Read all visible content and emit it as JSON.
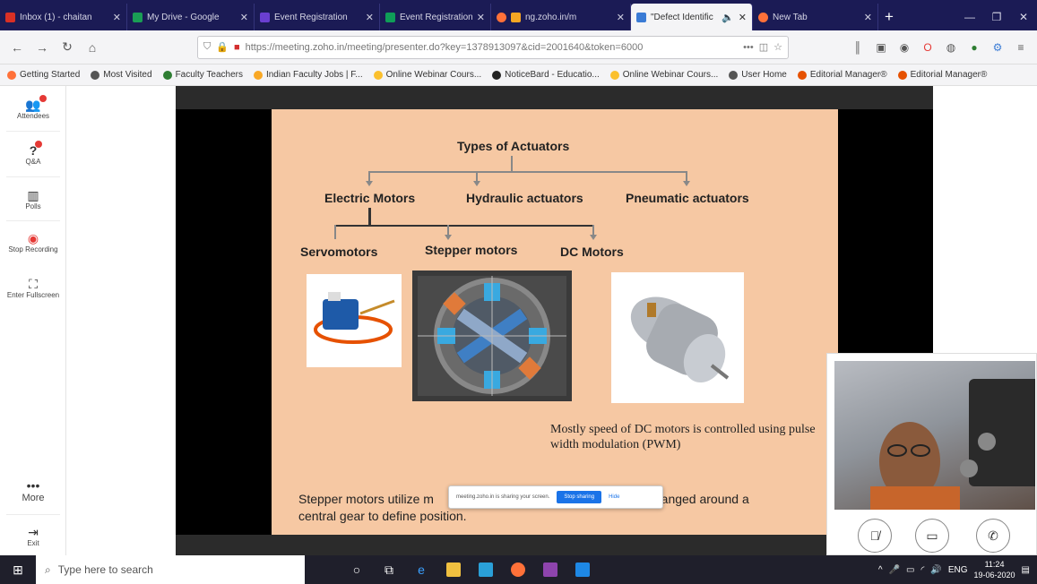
{
  "browser": {
    "tabs": [
      {
        "label": "Inbox (1) - chaitan",
        "color": "#d93025"
      },
      {
        "label": "My Drive - Google",
        "color": "#1a9e55"
      },
      {
        "label": "Event Registration",
        "color": "#6a3fd1"
      },
      {
        "label": "Event Registration",
        "color": "#0f9d58"
      },
      {
        "label": "ng.zoho.in/m",
        "color": "#f5a623"
      },
      {
        "label": "\"Defect Identific",
        "color": "#3a7bd5",
        "active": true
      },
      {
        "label": "New Tab",
        "color": "#ff7139"
      }
    ],
    "url": "https://meeting.zoho.in/meeting/presenter.do?key=1378913097&cid=2001640&token=6000",
    "bookmarks": [
      {
        "label": "Getting Started",
        "color": "#ff7139"
      },
      {
        "label": "Most Visited",
        "color": "#555555"
      },
      {
        "label": "Faculty Teachers",
        "color": "#2e7d32"
      },
      {
        "label": "Indian Faculty Jobs | F...",
        "color": "#f9a825"
      },
      {
        "label": "Online Webinar Cours...",
        "color": "#fbc02d"
      },
      {
        "label": "NoticeBard - Educatio...",
        "color": "#222222"
      },
      {
        "label": "Online Webinar Cours...",
        "color": "#fbc02d"
      },
      {
        "label": "User Home",
        "color": "#555555"
      },
      {
        "label": "Editorial Manager®",
        "color": "#e65100"
      },
      {
        "label": "Editorial Manager®",
        "color": "#e65100"
      }
    ]
  },
  "sidebar": {
    "items": [
      {
        "label": "Attendees",
        "icon": "attendees-icon",
        "glyph": "👥",
        "badge": true
      },
      {
        "label": "Q&A",
        "icon": "question-icon",
        "glyph": "?",
        "badge": true
      },
      {
        "label": "Polls",
        "icon": "polls-icon",
        "glyph": "▥",
        "badge": false
      },
      {
        "label": "Stop Recording",
        "icon": "record-icon",
        "glyph": "◉",
        "badge": false
      },
      {
        "label": "Enter Fullscreen",
        "icon": "fullscreen-icon",
        "glyph": "⛶",
        "badge": false
      }
    ],
    "more_label": "More",
    "exit_label": "Exit"
  },
  "slide": {
    "title": "Types of Actuators",
    "level1": [
      "Electric Motors",
      "Hydraulic actuators",
      "Pneumatic actuators"
    ],
    "level2": [
      "Servomotors",
      "Stepper motors",
      "DC Motors"
    ],
    "dc_note": "Mostly speed of DC motors is controlled using pulse width modulation (PWM)",
    "stepper_note_start": "Stepper motors utilize m",
    "stepper_note_end": "ranged around a",
    "stepper_note_line2": "central gear to define position."
  },
  "share_notice": {
    "text": "meeting.zoho.in is sharing your screen.",
    "stop_label": "Stop sharing",
    "hide_label": "Hide"
  },
  "video_controls": {
    "mic": "mic-muted-icon",
    "camera": "camera-icon",
    "call": "phone-icon"
  },
  "taskbar": {
    "search_placeholder": "Type here to search",
    "lang": "ENG",
    "time": "11:24",
    "date": "19-06-2020"
  }
}
